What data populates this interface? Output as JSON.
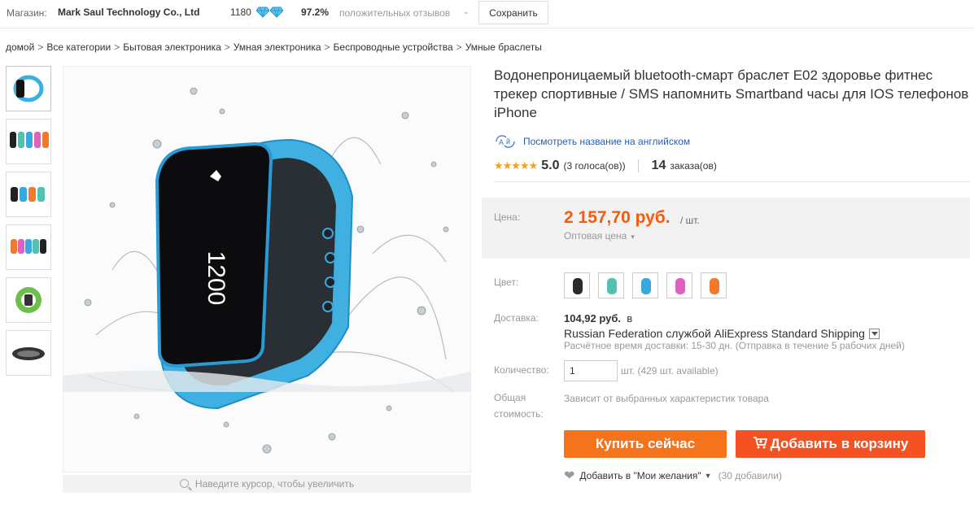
{
  "store": {
    "label": "Магазин:",
    "name": "Mark Saul Technology Co., Ltd",
    "rating": "1180",
    "feedback_pct": "97.2%",
    "feedback_label": "положительных отзывов",
    "save_label": "Сохранить"
  },
  "breadcrumb": [
    "домой",
    "Все категории",
    "Бытовая электроника",
    "Умная электроника",
    "Беспроводные устройства",
    "Умные браслеты"
  ],
  "gallery": {
    "zoom_hint": "Наведите курсор, чтобы увеличить"
  },
  "product": {
    "title": "Водонепроницаемый bluetooth-смарт браслет E02 здоровье фитнес трекер спортивные / SMS напомнить Smartband часы для IOS телефонов iPhone",
    "translate_link": "Посмотреть название на английском",
    "translate_icon": "translate-icon",
    "stars": "★★★★★",
    "score": "5.0",
    "votes": "(3 голоса(ов))",
    "orders": "14",
    "orders_label": "заказа(ов)"
  },
  "price": {
    "label": "Цена:",
    "value": "2 157,70 руб.",
    "unit": "/ шт.",
    "wholesale": "Оптовая цена"
  },
  "color": {
    "label": "Цвет:",
    "options": [
      "#2b2b2b",
      "#54c0b0",
      "#3aa8dc",
      "#e060c0",
      "#f07a2a"
    ]
  },
  "shipping": {
    "label": "Доставка:",
    "price": "104,92 руб.",
    "to": "в",
    "route": "Russian Federation службой AliExpress Standard Shipping",
    "time": "Расчётное время доставки: 15-30 дн. (Отправка в течение 5 рабочих дней)"
  },
  "quantity": {
    "label": "Количество:",
    "value": "1",
    "note": "шт. (429 шт. available)"
  },
  "total": {
    "label_1": "Общая",
    "label_2": "стоимость:",
    "value": "Зависит от выбранных характеристик товара"
  },
  "actions": {
    "buy_now": "Купить сейчас",
    "add_to_cart": "Добавить в корзину",
    "wishlist": "Добавить в \"Мои желания\"",
    "wishlist_count": "(30 добавили)"
  },
  "colors_theme": {
    "accent_orange": "#f5741b",
    "cart_red": "#f45222",
    "price_orange": "#f85a0c",
    "link_blue": "#2a5db0"
  }
}
